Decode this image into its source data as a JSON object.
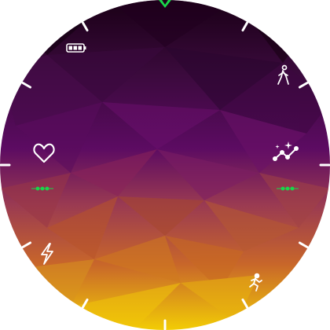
{
  "watch_face": {
    "background_colors": {
      "top": "#1a0016",
      "upper": "#3a0a3c",
      "middle": "#5c0b62",
      "lower_mid": "#9a3a52",
      "low": "#c8662a",
      "bottom": "#f2cc05"
    },
    "bezel": {
      "tick_color": "#ffffff",
      "tick_count": 12
    },
    "top_marker": {
      "icon": "green-chevron-icon",
      "color": "#19d64a"
    },
    "battery": {
      "icon": "battery-icon",
      "level": 1.0,
      "segments": 3
    },
    "complications": [
      {
        "id": "walk",
        "icon": "walking-person-icon",
        "color": "#ffffff"
      },
      {
        "id": "heart",
        "icon": "heart-outline-icon",
        "color": "#ffffff"
      },
      {
        "id": "insights",
        "icon": "sparkle-trend-icon",
        "color": "#ffffff"
      },
      {
        "id": "energy",
        "icon": "lightning-bolt-icon",
        "color": "#ffffff"
      },
      {
        "id": "workout",
        "icon": "running-person-icon",
        "color": "#ffffff"
      }
    ],
    "progress_dots": {
      "left": {
        "icon": "dots-indicator-icon",
        "color": "#19d64a",
        "count": 3
      },
      "right": {
        "icon": "dots-indicator-icon",
        "color": "#19d64a",
        "count": 3
      }
    }
  }
}
